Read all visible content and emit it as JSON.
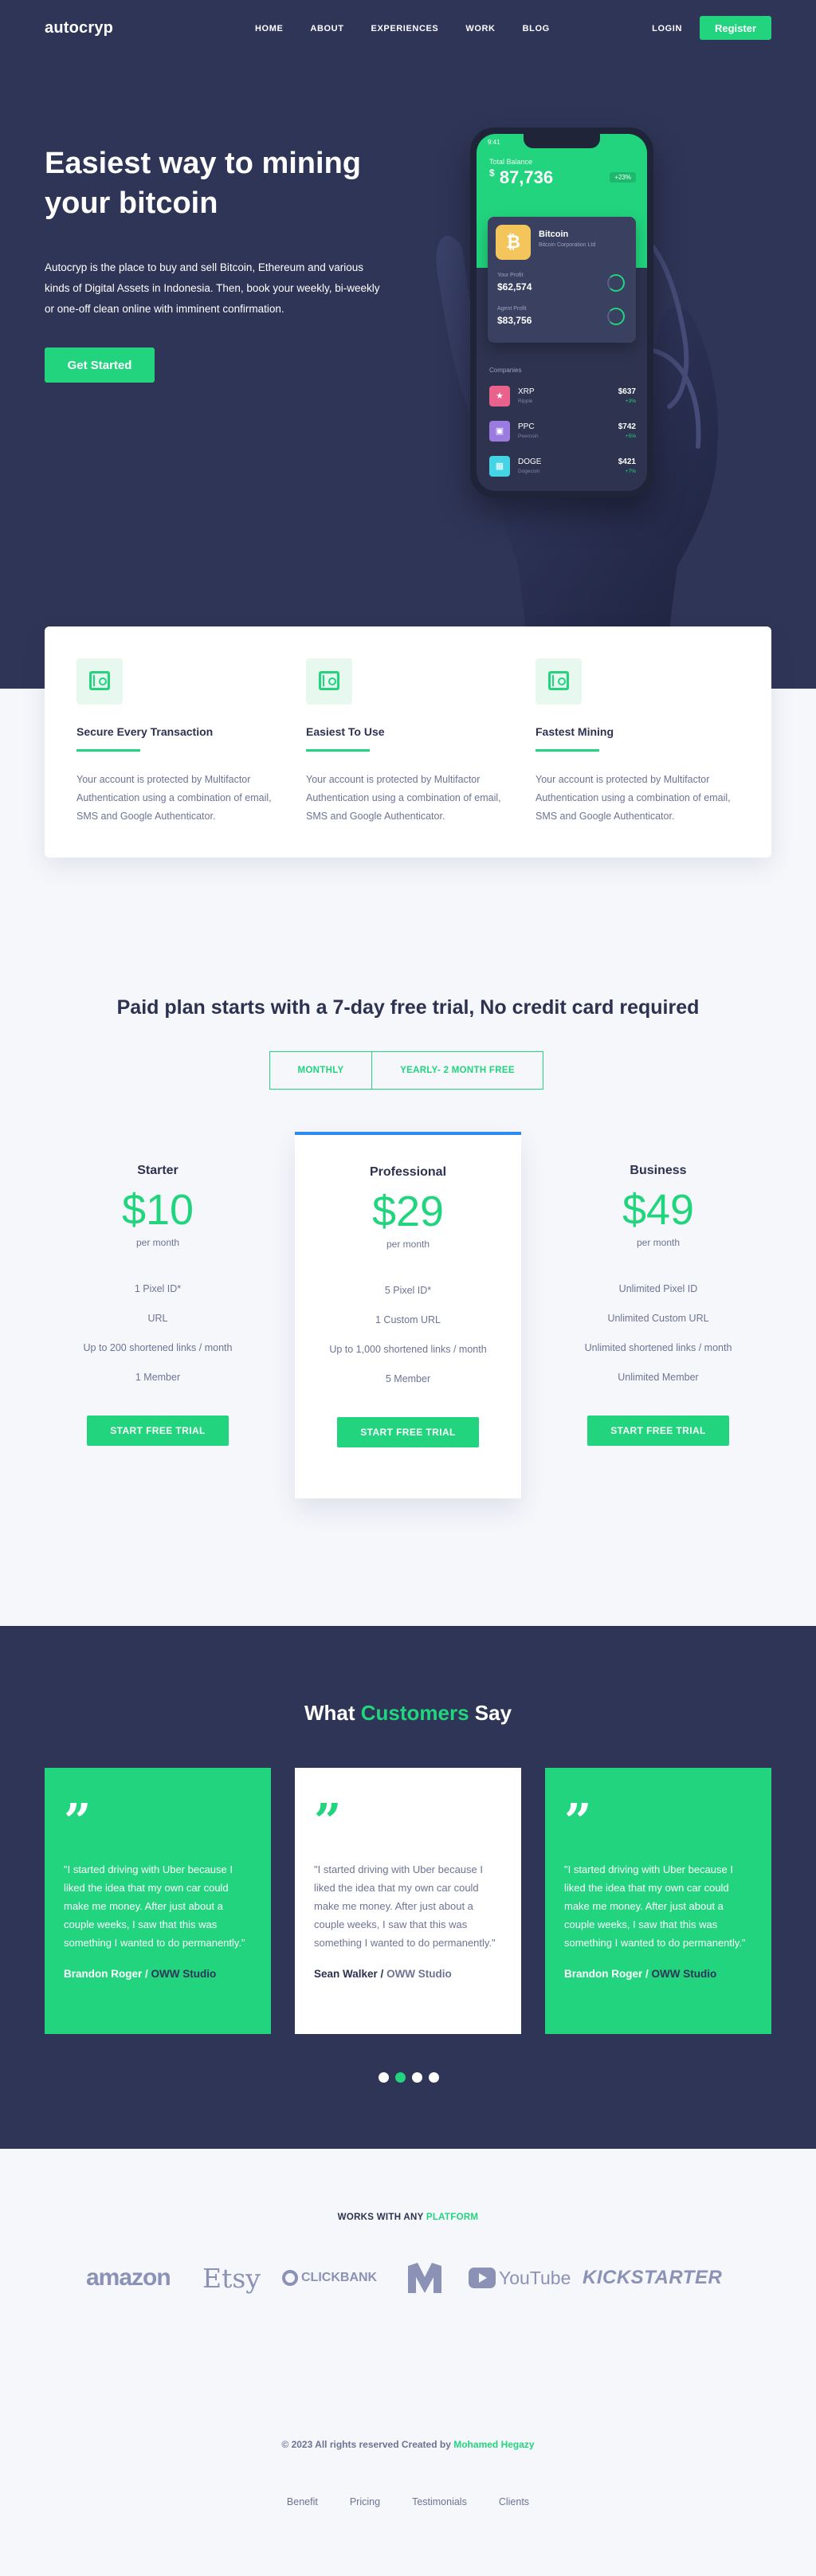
{
  "nav": {
    "logo": "autocryp",
    "menu": [
      "HOME",
      "ABOUT",
      "EXPERIENCES",
      "WORK",
      "BLOG"
    ],
    "login": "LOGIN",
    "register": "Register"
  },
  "hero": {
    "title": "Easiest way to mining your bitcoin",
    "description": "Autocryp is the place to buy and sell Bitcoin, Ethereum and various kinds of Digital Assets in Indonesia. Then, book your weekly, bi-weekly or one-off clean online with imminent confirmation.",
    "cta": "Get Started"
  },
  "phone": {
    "time": "9:41",
    "balance_label": "Total Balance",
    "balance_currency": "$",
    "balance_value": "87,736",
    "balance_change": "+23%",
    "coin": {
      "name": "Bitcoin",
      "sub": "Bitcoin Corporation Ltd",
      "stats": [
        {
          "label": "Your Profit",
          "value": "$62,574"
        },
        {
          "label": "Agent Profit",
          "value": "$83,756"
        }
      ]
    },
    "companies_title": "Companies",
    "companies": [
      {
        "name": "XRP",
        "sub": "Ripple",
        "price": "$637",
        "change": "+3%",
        "color": "#e8628c"
      },
      {
        "name": "PPC",
        "sub": "Peercoin",
        "price": "$742",
        "change": "+5%",
        "color": "#9b7be0"
      },
      {
        "name": "DOGE",
        "sub": "Dogecoin",
        "price": "$421",
        "change": "+7%",
        "color": "#43d4e6"
      }
    ]
  },
  "features": [
    {
      "title": "Secure Every Transaction",
      "text": "Your account is protected by Multifactor Authentication using a combination of email, SMS and Google Authenticator."
    },
    {
      "title": "Easiest To Use",
      "text": "Your account is protected by Multifactor Authentication using a combination of email, SMS and Google Authenticator."
    },
    {
      "title": "Fastest Mining",
      "text": "Your account is protected by Multifactor Authentication using a combination of email, SMS and Google Authenticator."
    }
  ],
  "pricing": {
    "title": "Paid plan starts with a 7-day free trial, No credit card required",
    "toggle": [
      "MONTHLY",
      "YEARLY- 2 MONTH FREE"
    ],
    "plans": [
      {
        "name": "Starter",
        "price": "$10",
        "per": "per month",
        "features": [
          "1 Pixel ID*",
          "URL",
          "Up to 200 shortened links / month",
          "1 Member"
        ],
        "button": "START FREE TRIAL"
      },
      {
        "name": "Professional",
        "price": "$29",
        "per": "per month",
        "features": [
          "5 Pixel ID*",
          "1 Custom URL",
          "Up to 1,000 shortened links / month",
          "5 Member"
        ],
        "button": "START FREE TRIAL"
      },
      {
        "name": "Business",
        "price": "$49",
        "per": "per month",
        "features": [
          "Unlimited Pixel ID",
          "Unlimited Custom URL",
          "Unlimited shortened links / month",
          "Unlimited Member"
        ],
        "button": "START FREE TRIAL"
      }
    ]
  },
  "testimonials": {
    "title_before": "What",
    "title_accent": "Customers",
    "title_after": "Say",
    "items": [
      {
        "quote": "\"I started driving with Uber because I liked the idea that my own car could make me money. After just about a couple weeks, I saw that this was something I wanted to do permanently.\"",
        "author": "Brandon Roger",
        "separator": " / ",
        "studio": "OWW Studio"
      },
      {
        "quote": "\"I started driving with Uber because I liked the idea that my own car could make me money. After just about a couple weeks, I saw that this was something I wanted to do permanently.\"",
        "author": "Sean Walker",
        "separator": " / ",
        "studio": "OWW Studio"
      },
      {
        "quote": "\"I started driving with Uber because I liked the idea that my own car could make me money. After just about a couple weeks, I saw that this was something I wanted to do permanently.\"",
        "author": "Brandon Roger",
        "separator": " / ",
        "studio": "OWW Studio"
      }
    ]
  },
  "platforms": {
    "title_before": "WORKS WITH ANY",
    "title_accent": "PLATFORM",
    "brands": [
      "amazon",
      "Etsy",
      "CLICKBANK",
      "YouTube",
      "KICKSTARTER"
    ]
  },
  "footer": {
    "copyright_before": "© 2023 All rights reserved Created by",
    "copyright_accent": "Mohamed Hegazy",
    "links": [
      "Benefit",
      "Pricing",
      "Testimonials",
      "Clients"
    ]
  },
  "colors": {
    "navy": "#2f3557",
    "green": "#22d47e",
    "blue": "#2f8bf1",
    "background": "#f5f7fb",
    "muted_text": "#6d7493"
  }
}
